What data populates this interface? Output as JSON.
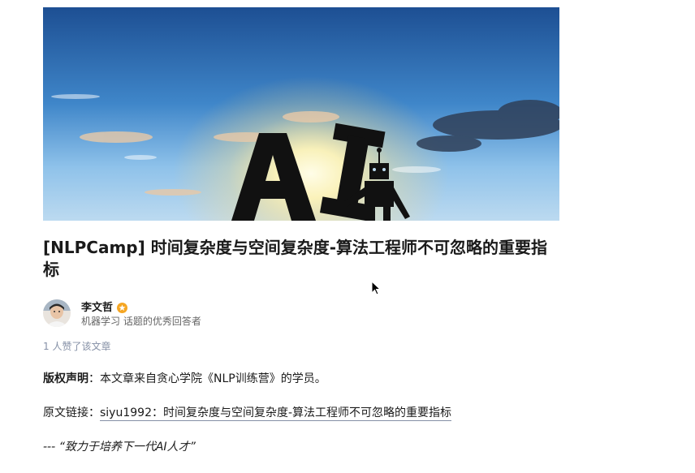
{
  "article": {
    "banner": {
      "caption_letters": "AI",
      "icon": "robot-icon"
    },
    "title": "[NLPCamp] 时间复杂度与空间复杂度-算法工程师不可忽略的重要指标",
    "author": {
      "name": "李文哲",
      "headline": "机器学习 话题的优秀回答者",
      "badge_icon": "excellent-answerer-badge-icon"
    },
    "likes_text": "1 人赞了该文章",
    "copyright": {
      "label": "版权声明",
      "text": "：本文章来自贪心学院《NLP训练营》的学员。"
    },
    "source": {
      "label": "原文链接：",
      "link_text": "siyu1992：时间复杂度与空间复杂度-算法工程师不可忽略的重要指标"
    },
    "motto": "--- “致力于培养下一代AI人才”"
  },
  "colors": {
    "title": "#1a1a1a",
    "meta": "#8590a6",
    "badge": "#f5a623"
  }
}
